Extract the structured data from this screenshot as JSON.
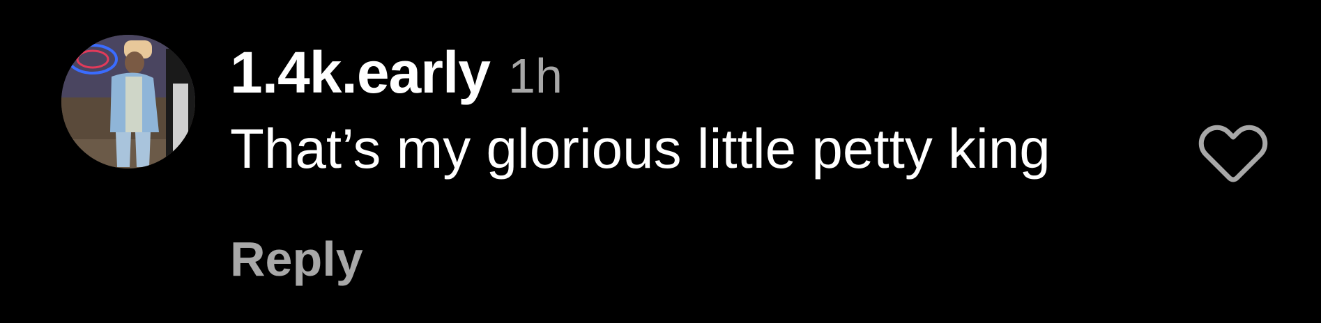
{
  "comment": {
    "username": "1.4k.early",
    "timestamp": "1h",
    "text": "That’s my glorious little petty king",
    "reply_label": "Reply",
    "liked": false
  },
  "icons": {
    "avatar": "avatar-photo",
    "like": "heart-outline-icon"
  },
  "colors": {
    "background": "#000000",
    "primary_text": "#ffffff",
    "secondary_text": "#a8a8a8",
    "icon": "#a8a8a8"
  }
}
